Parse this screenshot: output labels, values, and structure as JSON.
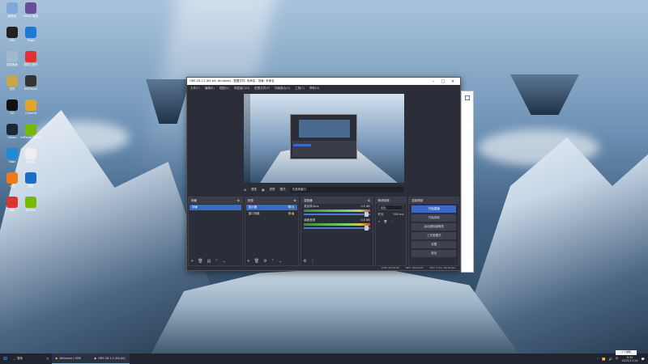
{
  "desktop_icons": [
    {
      "label": "回收站",
      "color": "#7fa8d8"
    },
    {
      "label": "Mirror 驱动",
      "color": "#6b4c9a"
    },
    {
      "label": "OBS",
      "color": "#222"
    },
    {
      "label": "Edge",
      "color": "#1a7ad4"
    },
    {
      "label": "控制面板",
      "color": "#a0b8d0"
    },
    {
      "label": "网易云音乐",
      "color": "#d33"
    },
    {
      "label": "文件",
      "color": "#caa54b"
    },
    {
      "label": "KMPlayer",
      "color": "#333"
    },
    {
      "label": "QQ",
      "color": "#111"
    },
    {
      "label": "Chrome",
      "color": "#e0a52a"
    },
    {
      "label": "Steam",
      "color": "#1b2838"
    },
    {
      "label": "GeForce Experience",
      "color": "#76b900"
    },
    {
      "label": "Edge",
      "color": "#1f8ad6"
    },
    {
      "label": "记事本",
      "color": "#eee"
    },
    {
      "label": "小白",
      "color": "#f07a1a"
    },
    {
      "label": "迅雷",
      "color": "#1a6ec9"
    },
    {
      "label": "360",
      "color": "#d33"
    },
    {
      "label": "NVIDIA",
      "color": "#76b900"
    }
  ],
  "obs": {
    "title": "OBS 28.1.2 (64-bit, windows) - 配置文件: 未命名 - 场景: 未命名",
    "menu": [
      "文件(F)",
      "编辑(E)",
      "视图(V)",
      "停靠窗口(D)",
      "配置文件(P)",
      "场景集合(S)",
      "工具(T)",
      "帮助(H)"
    ],
    "controls_bar": {
      "properties": "属性",
      "filters": "滤镜",
      "mode": "模式",
      "window_label": "无选择窗口"
    },
    "scenes": {
      "header": "场景",
      "items": [
        "场景"
      ]
    },
    "sources": {
      "header": "来源",
      "items": [
        {
          "label": "显示器",
          "selected": true
        },
        {
          "label": "窗口采集",
          "selected": false
        }
      ]
    },
    "mixer": {
      "header": "混音器",
      "channels": [
        {
          "name": "麦克风/Aux",
          "db": "0.0 dB"
        },
        {
          "name": "桌面音频",
          "db": "0.0 dB"
        }
      ]
    },
    "transitions": {
      "header": "转场特效",
      "type": "淡出",
      "duration_label": "时长",
      "duration_value": "300 ms"
    },
    "controls": {
      "header": "控制按钮",
      "buttons": [
        "开始直播",
        "开始录制",
        "启动虚拟摄像机",
        "工作室模式",
        "设置",
        "退出"
      ]
    },
    "status": {
      "live": "LIVE: 00:00:00",
      "rec": "REC: 00:00:00",
      "cpu": "CPU: 0.0%, 60.00 fps"
    }
  },
  "taskbar": {
    "search": "搜索",
    "apps": [
      {
        "label": "Welcome | OBS"
      },
      {
        "label": "OBS 28.1.2 (64-bit)"
      }
    ],
    "time": "9:32",
    "date": "2022/11/14",
    "tooltip": "1 个通知"
  }
}
